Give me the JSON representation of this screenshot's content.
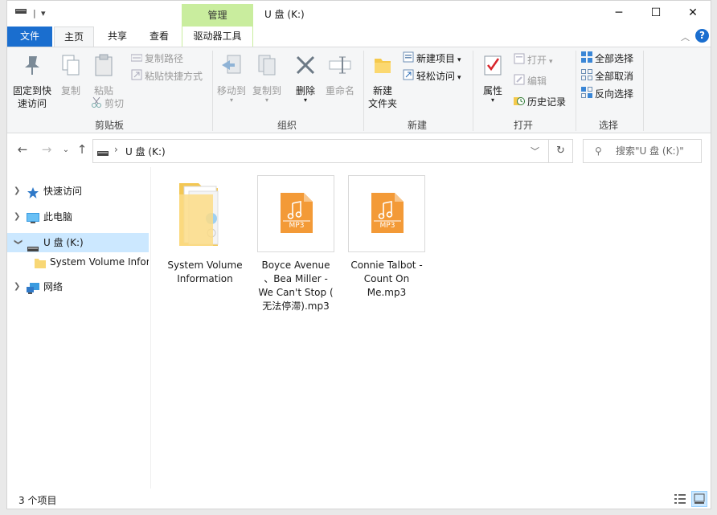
{
  "window": {
    "title": "U 盘 (K:)",
    "context_tab": "管理",
    "controls": {
      "minimize": "─",
      "maximize": "☐",
      "close": "✕"
    }
  },
  "quick_access_toolbar": {
    "separator": "|",
    "dropdown": "▾"
  },
  "tabs": {
    "file": "文件",
    "home": "主页",
    "share": "共享",
    "view": "查看",
    "drive_tools": "驱动器工具"
  },
  "ribbon": {
    "clipboard": {
      "title": "剪贴板",
      "pin_label_line1": "固定到快",
      "pin_label_line2": "速访问",
      "copy": "复制",
      "paste": "粘贴",
      "copy_path": "复制路径",
      "paste_shortcut": "粘贴快捷方式",
      "cut": "剪切"
    },
    "organize": {
      "title": "组织",
      "move_to": "移动到",
      "copy_to": "复制到",
      "delete": "删除",
      "rename": "重命名"
    },
    "new": {
      "title": "新建",
      "new_folder_line1": "新建",
      "new_folder_line2": "文件夹",
      "new_item": "新建项目",
      "easy_access": "轻松访问"
    },
    "open": {
      "title": "打开",
      "properties": "属性",
      "open": "打开",
      "edit": "编辑",
      "history": "历史记录"
    },
    "select": {
      "title": "选择",
      "select_all": "全部选择",
      "select_none": "全部取消",
      "invert": "反向选择"
    }
  },
  "address_bar": {
    "path": "U 盘 (K:)",
    "search_placeholder": "搜索\"U 盘 (K:)\""
  },
  "nav_pane": {
    "items": [
      {
        "label": "快速访问"
      },
      {
        "label": "此电脑"
      },
      {
        "label": "U 盘 (K:)"
      },
      {
        "label": "System Volume Information"
      },
      {
        "label": "网络"
      }
    ]
  },
  "files": [
    {
      "name_line1": "System Volume",
      "name_line2": "Information",
      "name_line3": "",
      "name_line4": "",
      "type": "folder"
    },
    {
      "name_line1": "Boyce Avenue",
      "name_line2": "、Bea Miller -",
      "name_line3": "We Can't Stop (",
      "name_line4": "无法停滞).mp3",
      "type": "mp3",
      "badge": "MP3"
    },
    {
      "name_line1": "Connie Talbot -",
      "name_line2": "Count On",
      "name_line3": "Me.mp3",
      "name_line4": "",
      "type": "mp3",
      "badge": "MP3"
    }
  ],
  "status_bar": {
    "item_count": "3 个项目"
  },
  "colors": {
    "accent": "#1a6ecf",
    "context_tab": "#c9ed9e",
    "selection": "#cce8ff",
    "mp3_orange": "#f39a37"
  }
}
